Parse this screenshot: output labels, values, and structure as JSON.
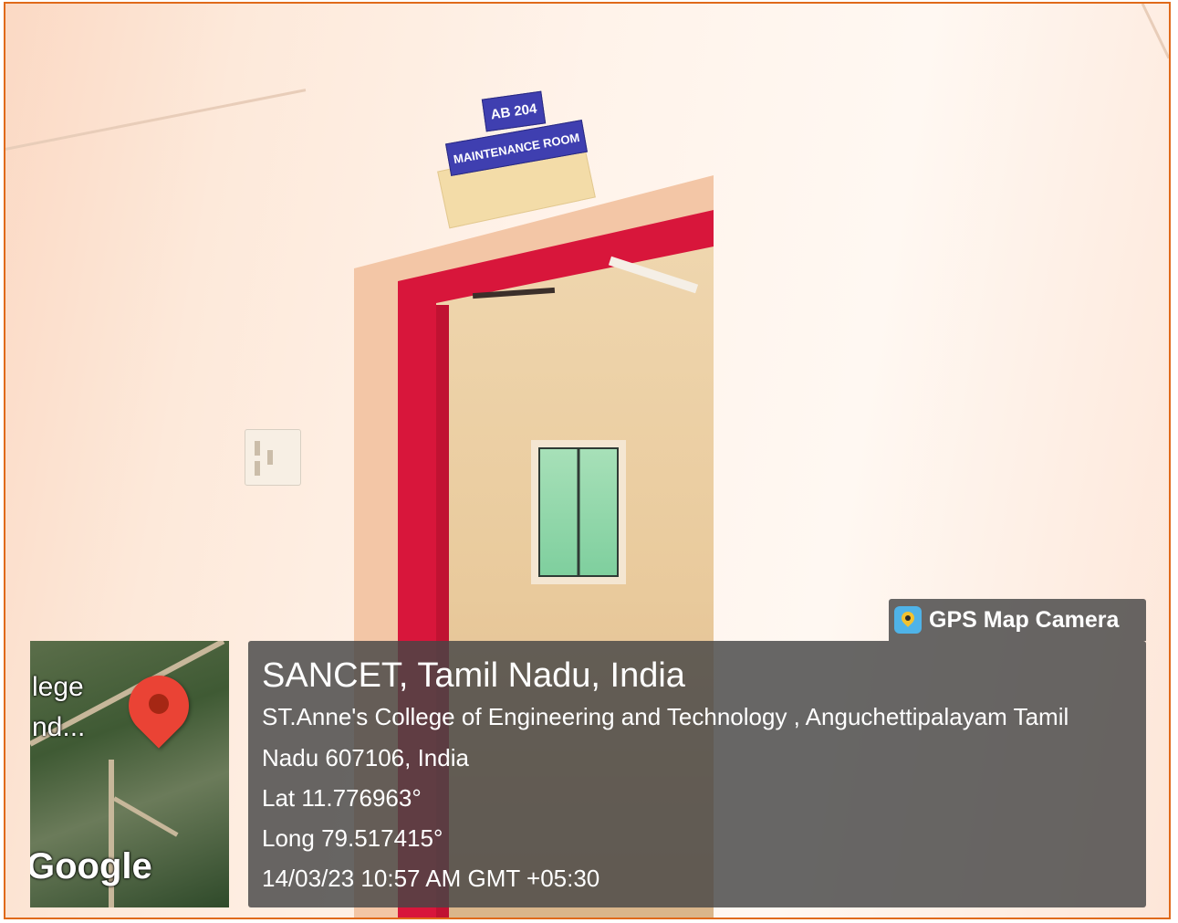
{
  "signs": {
    "room_number": "AB 204",
    "room_name": "MAINTENANCE ROOM"
  },
  "badge": {
    "icon": "gps-map-camera-icon",
    "label": "GPS Map Camera"
  },
  "map": {
    "label_top": "lege",
    "label_bottom": "nd...",
    "logo_text": "Google",
    "pin_color": "#ea4335"
  },
  "location": {
    "place": "SANCET, Tamil Nadu, India",
    "address_line1": "ST.Anne's College of Engineering and Technology , Anguchettipalayam Tamil",
    "address_line2": "Nadu 607106, India",
    "lat": "Lat 11.776963°",
    "long": "Long 79.517415°",
    "timestamp": "14/03/23 10:57 AM GMT +05:30"
  },
  "colors": {
    "frame_border": "#e06a1a",
    "door_frame": "#d8163b",
    "sign_blue": "#3f3fb0",
    "overlay_bg": "#464646"
  }
}
